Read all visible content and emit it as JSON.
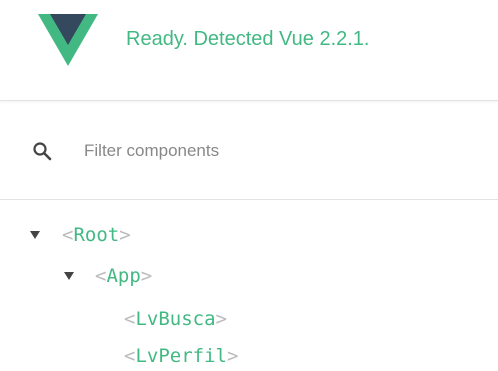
{
  "header": {
    "status_message": "Ready. Detected Vue 2.2.1.",
    "logo_icon": "vue-logo-icon",
    "colors": {
      "vue_green": "#42b983",
      "vue_dark": "#35495e"
    }
  },
  "search": {
    "icon": "search-icon",
    "placeholder": "Filter components",
    "value": ""
  },
  "tree": {
    "open_bracket": "<",
    "close_bracket": ">",
    "items": [
      {
        "name": "Root",
        "expanded": true,
        "arrow_icon": "caret-down-icon"
      },
      {
        "name": "App",
        "expanded": true,
        "arrow_icon": "caret-down-icon"
      },
      {
        "name": "LvBusca",
        "expanded": false
      },
      {
        "name": "LvPerfil",
        "expanded": false
      }
    ]
  }
}
